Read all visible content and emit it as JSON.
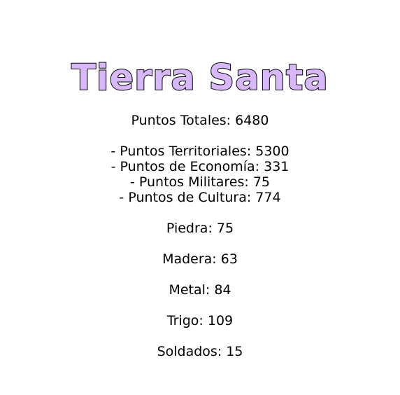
{
  "title": "Tierra Santa",
  "title_color": "#d8b8fa",
  "total_points": "Puntos Totales: 6480",
  "breakdown": {
    "territorial": "- Puntos Territoriales: 5300",
    "economy": "- Puntos de Economía: 331",
    "military": "- Puntos Militares: 75",
    "culture": "- Puntos de Cultura: 774"
  },
  "resources": {
    "stone": "Piedra: 75",
    "wood": "Madera: 63",
    "metal": "Metal: 84",
    "wheat": "Trigo: 109",
    "soldiers": "Soldados: 15"
  }
}
